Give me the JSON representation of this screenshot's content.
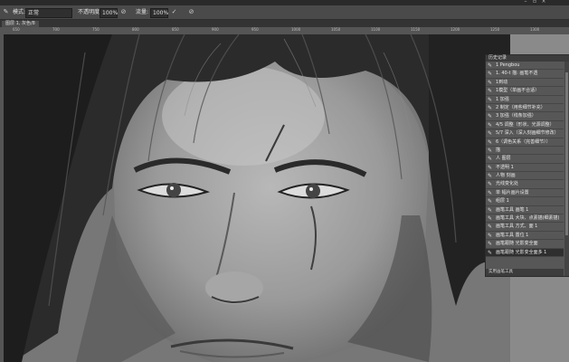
{
  "topbar": {
    "right_text": "工作区域 100"
  },
  "options": {
    "mode_label": "模式:",
    "mode_value": "正常",
    "opacity_label": "不透明度:",
    "opacity_value": "100%",
    "flow_label": "流量:",
    "flow_value": "100%"
  },
  "document": {
    "tab_label": "图层 1, 灰色/8"
  },
  "ruler": {
    "ticks": [
      "650",
      "700",
      "750",
      "800",
      "850",
      "900",
      "950",
      "1000",
      "1050",
      "1100",
      "1150",
      "1200",
      "1250",
      "1300"
    ]
  },
  "history": {
    "title": "历史记录",
    "items": [
      "1 Pengbou",
      "1. 40-t 描: 画笔不透",
      "1到动",
      "1模型（单画不合适）",
      "1 加强",
      "2 制定（用些细节补充）",
      "3 加强（线条加强）",
      "4/5 调整（形状、光源调整）",
      "5/7 深入（深入刻画细节修改）",
      "6（调色关系（完善细节））",
      "描",
      "人 图层",
      "不透明 1",
      "人物 刻画",
      "光线变化处",
      "单 幅片画片设置",
      "组层 1",
      "画笔工具 画笔 1",
      "画笔工具 大块、点素描(细素描)",
      "画笔工具 方式、面 1",
      "画笔工具 置位 1",
      "画笔跟随 光影变全面",
      "画笔跟随 光影变全面多 1"
    ],
    "footer": "实用画笔工具"
  },
  "colors": {
    "panel_bg": "#575757",
    "canvas_bg": "#7a7a7a",
    "chrome": "#4a4a4a"
  }
}
